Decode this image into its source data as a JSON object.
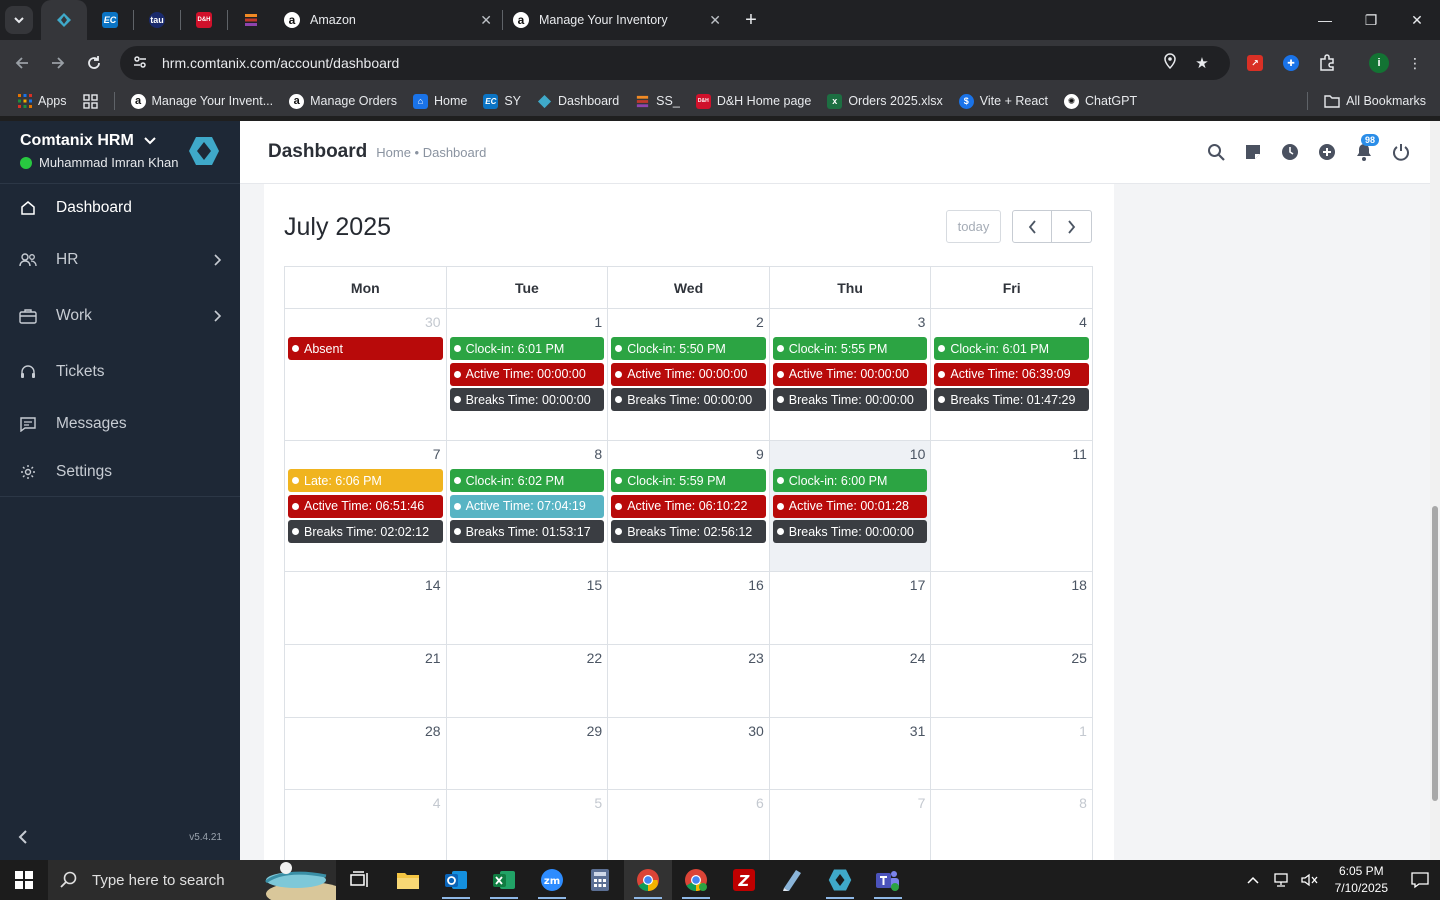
{
  "browser": {
    "tabs": [
      {
        "label": "Amazon"
      },
      {
        "label": "Manage Your Inventory"
      }
    ],
    "url": "hrm.comtanix.com/account/dashboard",
    "bookmarks": {
      "apps": "Apps",
      "items": [
        "Manage Your Invent...",
        "Manage Orders",
        "Home",
        "SY",
        "Dashboard",
        "SS_",
        "D&H Home page",
        "Orders 2025.xlsx",
        "Vite + React",
        "ChatGPT"
      ],
      "all": "All Bookmarks"
    },
    "profile_initial": "i"
  },
  "sidebar": {
    "app_name": "Comtanix HRM",
    "user_name": "Muhammad Imran Khan",
    "status": "online",
    "items": [
      {
        "label": "Dashboard",
        "icon": "home-icon"
      },
      {
        "label": "HR",
        "icon": "users-icon"
      },
      {
        "label": "Work",
        "icon": "briefcase-icon"
      },
      {
        "label": "Tickets",
        "icon": "headset-icon"
      },
      {
        "label": "Messages",
        "icon": "message-icon"
      },
      {
        "label": "Settings",
        "icon": "gear-icon"
      }
    ],
    "version": "v5.4.21"
  },
  "header": {
    "title": "Dashboard",
    "breadcrumb": "Home • Dashboard",
    "notification_count": "98"
  },
  "calendar": {
    "month_title": "July 2025",
    "today_label": "today",
    "weekdays": [
      "Mon",
      "Tue",
      "Wed",
      "Thu",
      "Fri"
    ],
    "weeks": [
      [
        {
          "day": "30",
          "other": true,
          "events": [
            {
              "type": "red",
              "text": "Absent"
            }
          ]
        },
        {
          "day": "1",
          "events": [
            {
              "type": "green",
              "text": "Clock-in: 6:01 PM"
            },
            {
              "type": "red",
              "text": "Active Time: 00:00:00"
            },
            {
              "type": "dark",
              "text": "Breaks Time: 00:00:00"
            }
          ]
        },
        {
          "day": "2",
          "events": [
            {
              "type": "green",
              "text": "Clock-in: 5:50 PM"
            },
            {
              "type": "red",
              "text": "Active Time: 00:00:00"
            },
            {
              "type": "dark",
              "text": "Breaks Time: 00:00:00"
            }
          ]
        },
        {
          "day": "3",
          "events": [
            {
              "type": "green",
              "text": "Clock-in: 5:55 PM"
            },
            {
              "type": "red",
              "text": "Active Time: 00:00:00"
            },
            {
              "type": "dark",
              "text": "Breaks Time: 00:00:00"
            }
          ]
        },
        {
          "day": "4",
          "events": [
            {
              "type": "green",
              "text": "Clock-in: 6:01 PM"
            },
            {
              "type": "red",
              "text": "Active Time: 06:39:09"
            },
            {
              "type": "dark",
              "text": "Breaks Time: 01:47:29"
            }
          ]
        }
      ],
      [
        {
          "day": "7",
          "events": [
            {
              "type": "yellow",
              "text": "Late: 6:06 PM"
            },
            {
              "type": "red",
              "text": "Active Time: 06:51:46"
            },
            {
              "type": "dark",
              "text": "Breaks Time: 02:02:12"
            }
          ]
        },
        {
          "day": "8",
          "events": [
            {
              "type": "green",
              "text": "Clock-in: 6:02 PM"
            },
            {
              "type": "teal",
              "text": "Active Time: 07:04:19"
            },
            {
              "type": "dark",
              "text": "Breaks Time: 01:53:17"
            }
          ]
        },
        {
          "day": "9",
          "events": [
            {
              "type": "green",
              "text": "Clock-in: 5:59 PM"
            },
            {
              "type": "red",
              "text": "Active Time: 06:10:22"
            },
            {
              "type": "dark",
              "text": "Breaks Time: 02:56:12"
            }
          ]
        },
        {
          "day": "10",
          "today": true,
          "events": [
            {
              "type": "green",
              "text": "Clock-in: 6:00 PM"
            },
            {
              "type": "red",
              "text": "Active Time: 00:01:28"
            },
            {
              "type": "dark",
              "text": "Breaks Time: 00:00:00"
            }
          ]
        },
        {
          "day": "11",
          "events": []
        }
      ],
      [
        {
          "day": "14",
          "events": []
        },
        {
          "day": "15",
          "events": []
        },
        {
          "day": "16",
          "events": []
        },
        {
          "day": "17",
          "events": []
        },
        {
          "day": "18",
          "events": []
        }
      ],
      [
        {
          "day": "21",
          "events": []
        },
        {
          "day": "22",
          "events": []
        },
        {
          "day": "23",
          "events": []
        },
        {
          "day": "24",
          "events": []
        },
        {
          "day": "25",
          "events": []
        }
      ],
      [
        {
          "day": "28",
          "events": []
        },
        {
          "day": "29",
          "events": []
        },
        {
          "day": "30",
          "events": []
        },
        {
          "day": "31",
          "events": []
        },
        {
          "day": "1",
          "other": true,
          "events": []
        }
      ],
      [
        {
          "day": "4",
          "other": true,
          "events": []
        },
        {
          "day": "5",
          "other": true,
          "events": []
        },
        {
          "day": "6",
          "other": true,
          "events": []
        },
        {
          "day": "7",
          "other": true,
          "events": []
        },
        {
          "day": "8",
          "other": true,
          "events": []
        }
      ]
    ]
  },
  "taskbar": {
    "search_placeholder": "Type here to search",
    "time": "6:05 PM",
    "date": "7/10/2025"
  },
  "colors": {
    "sidebar_bg": "#1e2836",
    "event_green": "#2ca443",
    "event_red": "#b80a0a",
    "event_dark": "#3a3d42",
    "event_yellow": "#f0b41f",
    "event_teal": "#58b4c4",
    "status_online": "#28c840",
    "badge_blue": "#2a8de8"
  }
}
